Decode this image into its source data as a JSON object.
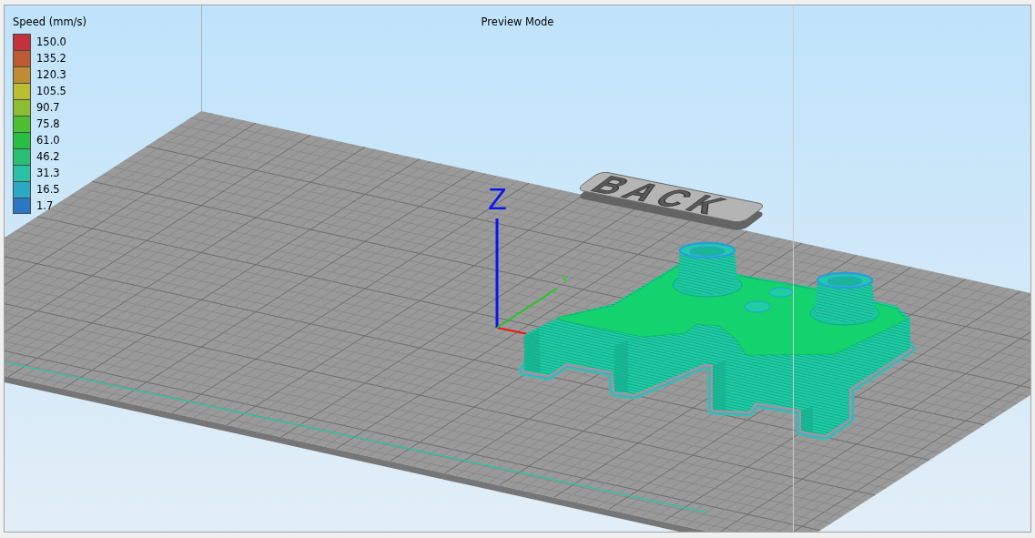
{
  "viewport": {
    "title": "Preview Mode"
  },
  "legend": {
    "title": "Speed (mm/s)",
    "entries": [
      {
        "value": "150.0",
        "color": "#c1323a"
      },
      {
        "value": "135.2",
        "color": "#be5a32"
      },
      {
        "value": "120.3",
        "color": "#be8c32"
      },
      {
        "value": "105.5",
        "color": "#b9be32"
      },
      {
        "value": "90.7",
        "color": "#8cbe32"
      },
      {
        "value": "75.8",
        "color": "#4ebe32"
      },
      {
        "value": "61.0",
        "color": "#28be41"
      },
      {
        "value": "46.2",
        "color": "#2abe73"
      },
      {
        "value": "31.3",
        "color": "#2ac0a5"
      },
      {
        "value": "16.5",
        "color": "#2aa8c4"
      },
      {
        "value": "1.7",
        "color": "#2a78c4"
      }
    ]
  },
  "scene": {
    "axis_labels": {
      "z": "Z",
      "y": "Y"
    },
    "tab_label": "BACK"
  }
}
